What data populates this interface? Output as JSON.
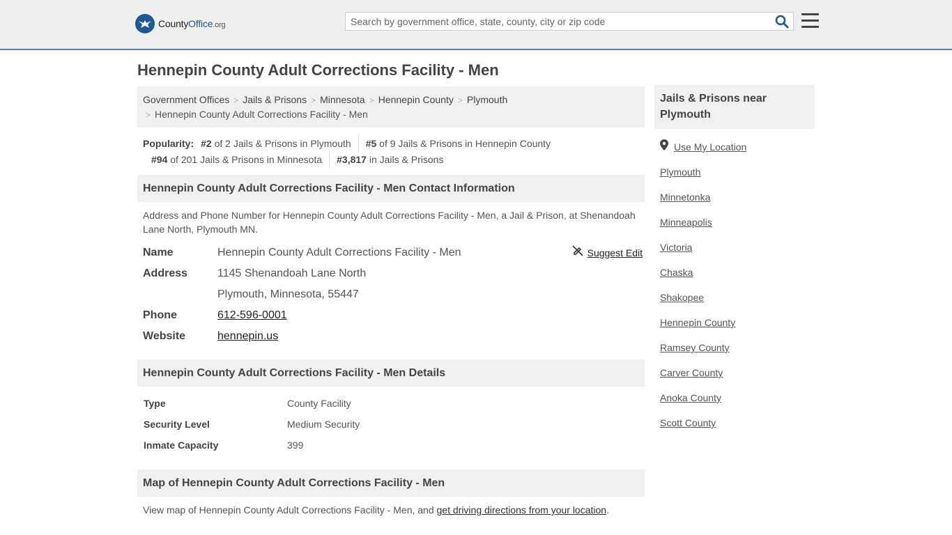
{
  "header": {
    "logo_county": "County",
    "logo_office": "Office",
    "logo_org": ".org",
    "search_placeholder": "Search by government office, state, county, city or zip code"
  },
  "page_title": "Hennepin County Adult Corrections Facility - Men",
  "breadcrumb": {
    "items": [
      "Government Offices",
      "Jails & Prisons",
      "Minnesota",
      "Hennepin County",
      "Plymouth"
    ],
    "current": "Hennepin County Adult Corrections Facility - Men"
  },
  "popularity": {
    "label": "Popularity:",
    "items": [
      {
        "rank": "#2",
        "text": " of 2 Jails & Prisons in Plymouth"
      },
      {
        "rank": "#5",
        "text": " of 9 Jails & Prisons in Hennepin County"
      },
      {
        "rank": "#94",
        "text": " of 201 Jails & Prisons in Minnesota"
      },
      {
        "rank": "#3,817",
        "text": " in Jails & Prisons"
      }
    ]
  },
  "contact": {
    "heading": "Hennepin County Adult Corrections Facility - Men Contact Information",
    "description": "Address and Phone Number for Hennepin County Adult Corrections Facility - Men, a Jail & Prison, at Shenandoah Lane North, Plymouth MN.",
    "suggest_edit": "Suggest Edit",
    "name_label": "Name",
    "name_value": "Hennepin County Adult Corrections Facility - Men",
    "address_label": "Address",
    "address_line1": "1145 Shenandoah Lane North",
    "address_line2": "Plymouth, Minnesota, 55447",
    "phone_label": "Phone",
    "phone_value": "612-596-0001",
    "website_label": "Website",
    "website_value": "hennepin.us"
  },
  "details": {
    "heading": "Hennepin County Adult Corrections Facility - Men Details",
    "rows": [
      {
        "label": "Type",
        "value": "County Facility"
      },
      {
        "label": "Security Level",
        "value": "Medium Security"
      },
      {
        "label": "Inmate Capacity",
        "value": "399"
      }
    ]
  },
  "map": {
    "heading": "Map of Hennepin County Adult Corrections Facility - Men",
    "text_before": "View map of Hennepin County Adult Corrections Facility - Men, and ",
    "link": "get driving directions from your location",
    "text_after": "."
  },
  "sidebar": {
    "heading": "Jails & Prisons near Plymouth",
    "use_location": "Use My Location",
    "links": [
      "Plymouth",
      "Minnetonka",
      "Minneapolis",
      "Victoria",
      "Chaska",
      "Shakopee",
      "Hennepin County",
      "Ramsey County",
      "Carver County",
      "Anoka County",
      "Scott County"
    ]
  }
}
